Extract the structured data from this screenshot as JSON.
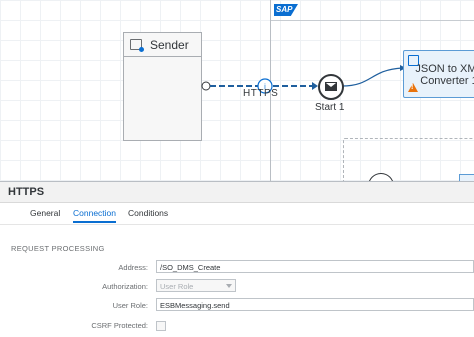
{
  "canvas": {
    "sender": {
      "label": "Sender"
    },
    "connection": {
      "label": "HTTPS"
    },
    "start_event": {
      "label": "Start 1"
    },
    "converter": {
      "label_line1": "JSON to XML",
      "label_line2": "Converter 1"
    },
    "logo_text": "SAP"
  },
  "panel": {
    "title": "HTTPS",
    "tabs": [
      {
        "label": "General",
        "active": false
      },
      {
        "label": "Connection",
        "active": true
      },
      {
        "label": "Conditions",
        "active": false
      }
    ],
    "section_title": "REQUEST PROCESSING",
    "fields": {
      "address": {
        "label": "Address:",
        "value": "/SO_DMS_Create"
      },
      "authorization": {
        "label": "Authorization:",
        "placeholder": "User Role"
      },
      "user_role": {
        "label": "User Role:",
        "value": "ESBMessaging.send"
      },
      "csrf": {
        "label": "CSRF Protected:",
        "checked": false
      }
    }
  },
  "colors": {
    "accent": "#0a6ed1",
    "warning": "#e9730c",
    "connector": "#1f5f9e"
  }
}
